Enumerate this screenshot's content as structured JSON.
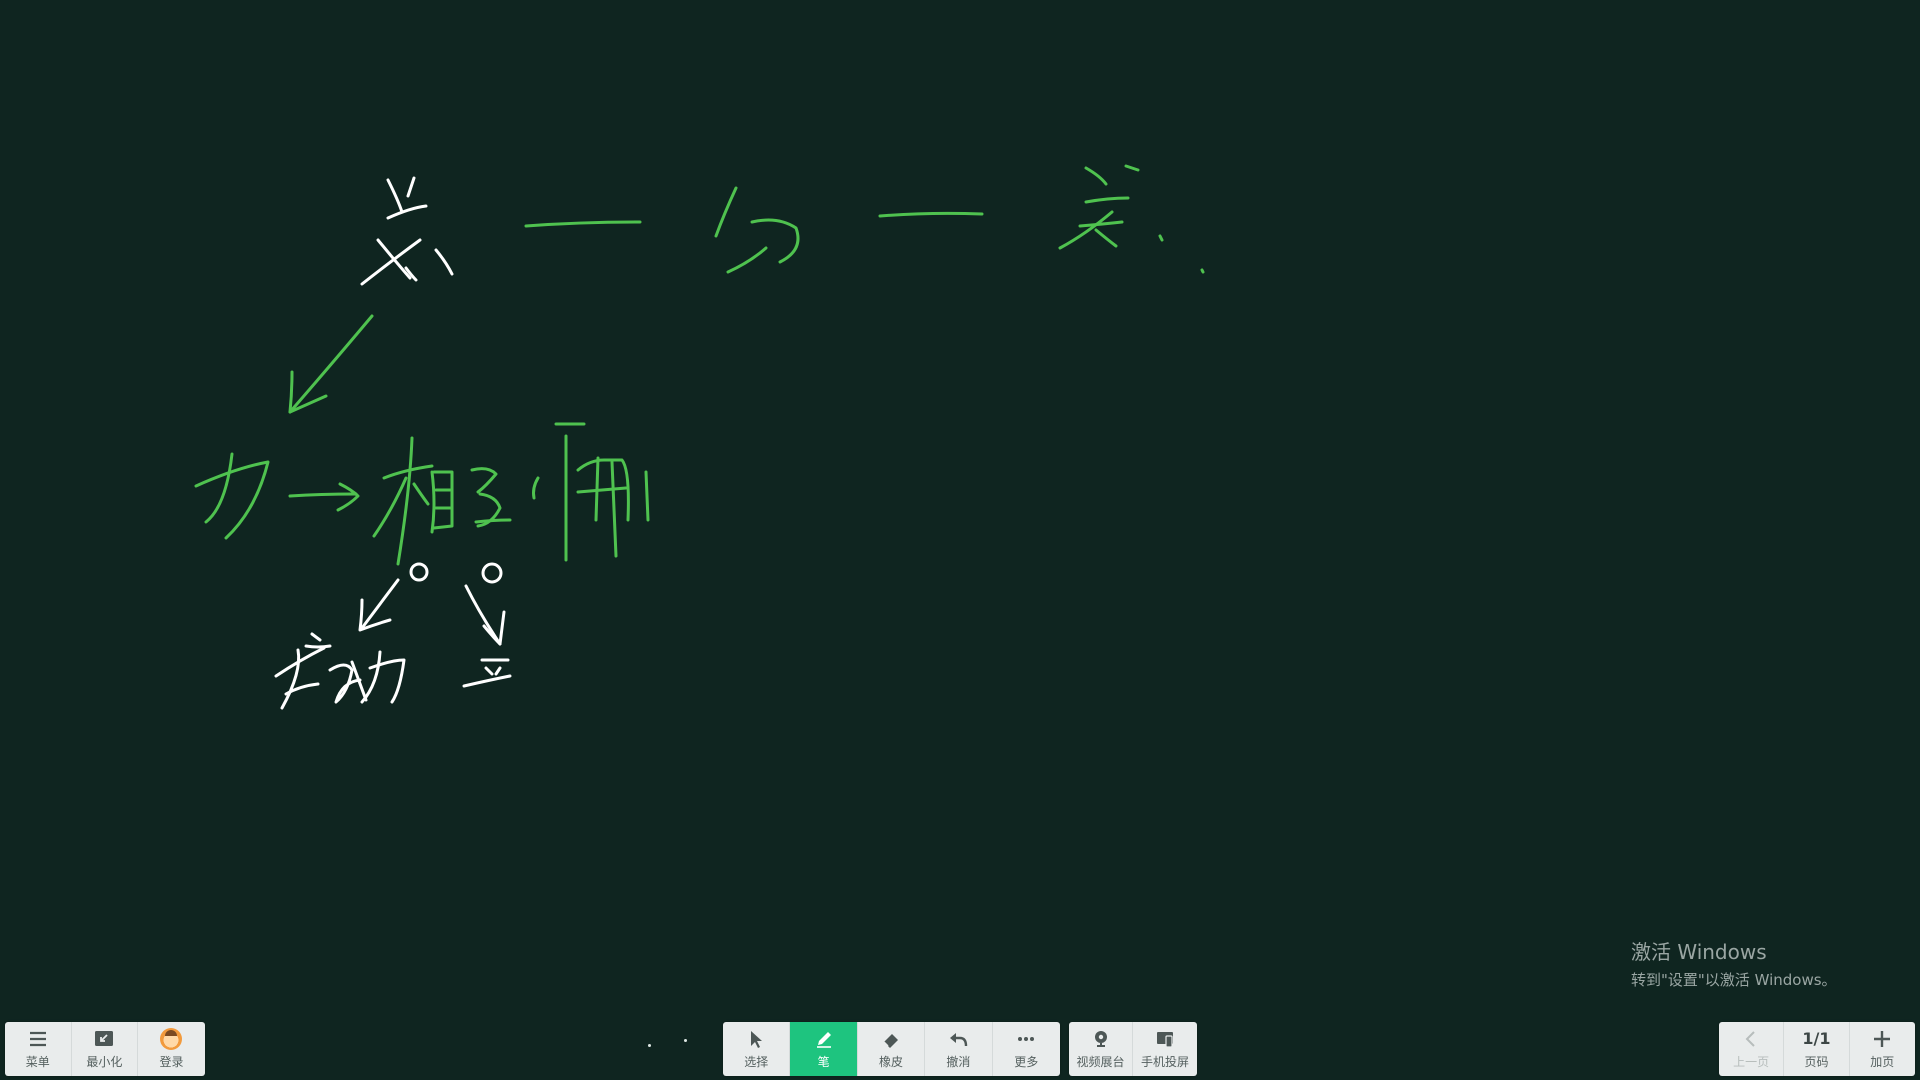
{
  "app": {
    "background_color": "#0f2520",
    "accent_color": "#1ec47f"
  },
  "canvas": {
    "ink_colors": {
      "green": "#4fc24f",
      "white": "#ffffff"
    }
  },
  "left_toolbar": {
    "items": [
      {
        "label": "菜单",
        "icon": "menu-icon"
      },
      {
        "label": "最小化",
        "icon": "minimize-icon"
      },
      {
        "label": "登录",
        "icon": "avatar-icon"
      }
    ]
  },
  "center_toolbar": {
    "items": [
      {
        "label": "选择",
        "icon": "cursor-icon"
      },
      {
        "label": "笔",
        "icon": "pen-icon",
        "active": true
      },
      {
        "label": "橡皮",
        "icon": "eraser-icon"
      },
      {
        "label": "撤消",
        "icon": "undo-icon"
      },
      {
        "label": "更多",
        "icon": "more-icon"
      }
    ]
  },
  "cast_toolbar": {
    "items": [
      {
        "label": "视频展台",
        "icon": "camera-icon"
      },
      {
        "label": "手机投屏",
        "icon": "phone-cast-icon"
      }
    ]
  },
  "right_toolbar": {
    "items": [
      {
        "label": "上一页",
        "icon": "chevron-left-icon",
        "disabled": true
      },
      {
        "label": "页码",
        "value": "1/1"
      },
      {
        "label": "加页",
        "icon": "plus-icon"
      }
    ]
  },
  "watermark": {
    "title": "激活 Windows",
    "subtitle": "转到\"设置\"以激活 Windows。"
  }
}
